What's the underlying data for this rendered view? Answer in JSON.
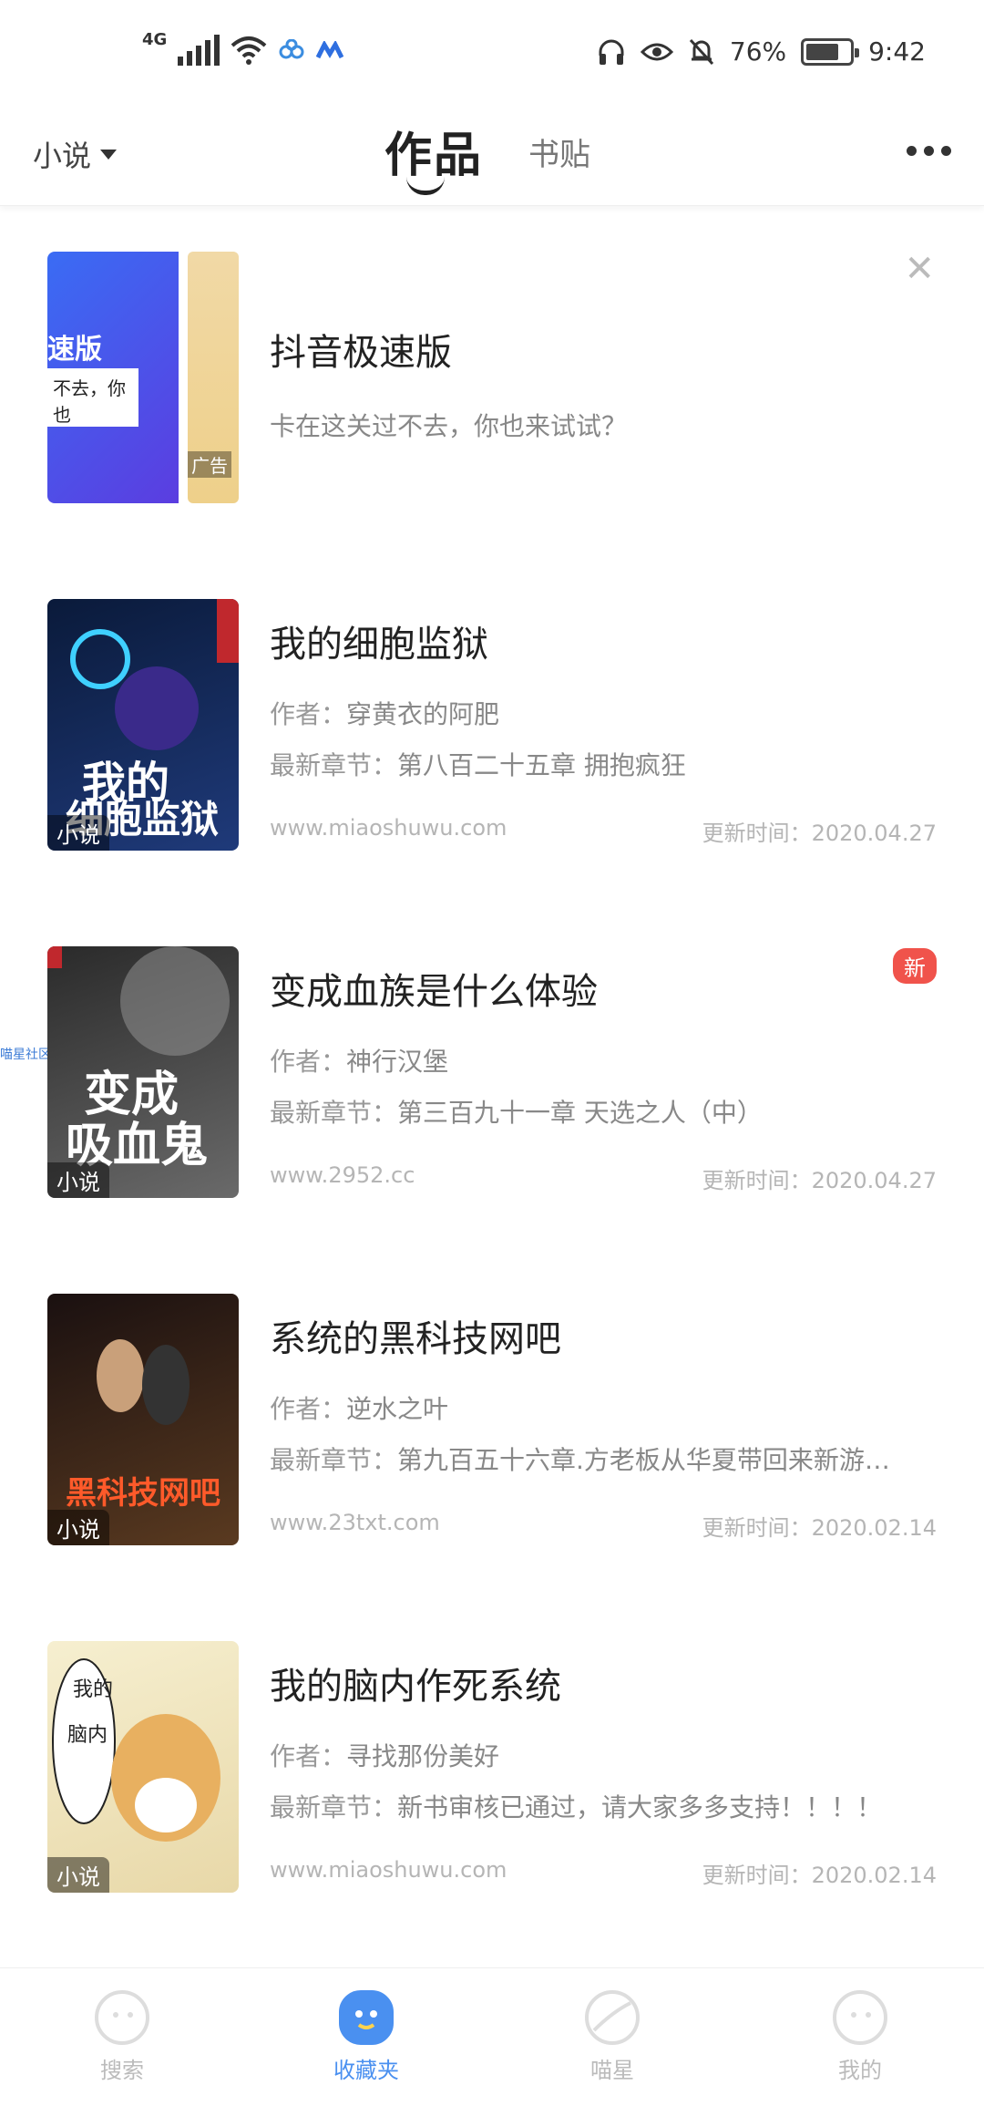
{
  "status_bar": {
    "network": "4G",
    "battery_percent": "76%",
    "time": "9:42"
  },
  "top_nav": {
    "category": "小说",
    "tabs": [
      "作品",
      "书贴"
    ]
  },
  "ad": {
    "title": "抖音极速版",
    "subtitle": "卡在这关过不去，你也来试试？",
    "cover_text_big": "速版",
    "cover_text_card": "不去，你也",
    "cover_badge": "广告"
  },
  "books": [
    {
      "title": "我的细胞监狱",
      "author_key": "作者：",
      "author": "穿黄衣的阿肥",
      "chapter_key": "最新章节：",
      "chapter": "第八百二十五章 拥抱疯狂",
      "source": "www.miaoshuwu.com",
      "update_key": "更新时间：",
      "update": "2020.04.27",
      "tag": "小说",
      "cover_colors": [
        "#0a1a3a",
        "#1f3a7a"
      ]
    },
    {
      "title": "变成血族是什么体验",
      "author_key": "作者：",
      "author": "神行汉堡",
      "chapter_key": "最新章节：",
      "chapter": "第三百九十一章 天选之人（中）",
      "source": "www.2952.cc",
      "update_key": "更新时间：",
      "update": "2020.04.27",
      "tag": "小说",
      "badge": "新",
      "cover_colors": [
        "#2a2a2a",
        "#6a6a6a"
      ]
    },
    {
      "title": "系统的黑科技网吧",
      "author_key": "作者：",
      "author": "逆水之叶",
      "chapter_key": "最新章节：",
      "chapter": "第九百五十六章.方老板从华夏带回来新游戏…",
      "source": "www.23txt.com",
      "update_key": "更新时间：",
      "update": "2020.02.14",
      "tag": "小说",
      "cover_colors": [
        "#1a1010",
        "#5a3a20"
      ]
    },
    {
      "title": "我的脑内作死系统",
      "author_key": "作者：",
      "author": "寻找那份美好",
      "chapter_key": "最新章节：",
      "chapter": "新书审核已通过，请大家多多支持！！！！",
      "source": "www.miaoshuwu.com",
      "update_key": "更新时间：",
      "update": "2020.02.14",
      "tag": "小说",
      "cover_colors": [
        "#f6efd0",
        "#e8d8a8"
      ]
    }
  ],
  "side_tab": "喵星社区",
  "tabbar": [
    {
      "label": "搜索",
      "icon": "search-face-icon"
    },
    {
      "label": "收藏夹",
      "icon": "favorites-icon"
    },
    {
      "label": "喵星",
      "icon": "planet-icon"
    },
    {
      "label": "我的",
      "icon": "profile-icon"
    }
  ],
  "colors": {
    "accent": "#4a90f0",
    "new_badge": "#f0534b"
  }
}
